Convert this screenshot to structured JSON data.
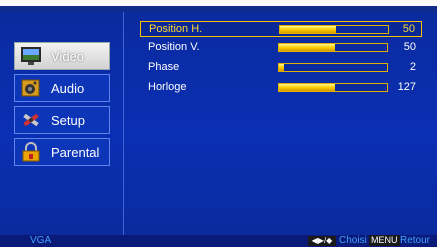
{
  "sidebar": {
    "items": [
      {
        "label": "Video",
        "icon": "monitor-icon",
        "selected": true
      },
      {
        "label": "Audio",
        "icon": "speaker-icon",
        "selected": false
      },
      {
        "label": "Setup",
        "icon": "tools-icon",
        "selected": false
      },
      {
        "label": "Parental",
        "icon": "lock-icon",
        "selected": false
      }
    ]
  },
  "settings": {
    "rows": [
      {
        "label": "Position H.",
        "value": "50",
        "level": 0.52,
        "selected": true
      },
      {
        "label": "Position V.",
        "value": "50",
        "level": 0.52,
        "selected": false
      },
      {
        "label": "Phase",
        "value": "2",
        "level": 0.05,
        "selected": false
      },
      {
        "label": "Horloge",
        "value": "127",
        "level": 0.52,
        "selected": false
      }
    ]
  },
  "footer": {
    "source": "VGA",
    "nav_key": "◀▶/◆",
    "nav_label": "Choisi",
    "menu_key": "MENU",
    "menu_label": "Retour"
  },
  "colors": {
    "background": "#0b2fb4",
    "highlight": "#ffd630",
    "bar_fill": "#ffd000",
    "footer_text": "#3fa0ff"
  }
}
